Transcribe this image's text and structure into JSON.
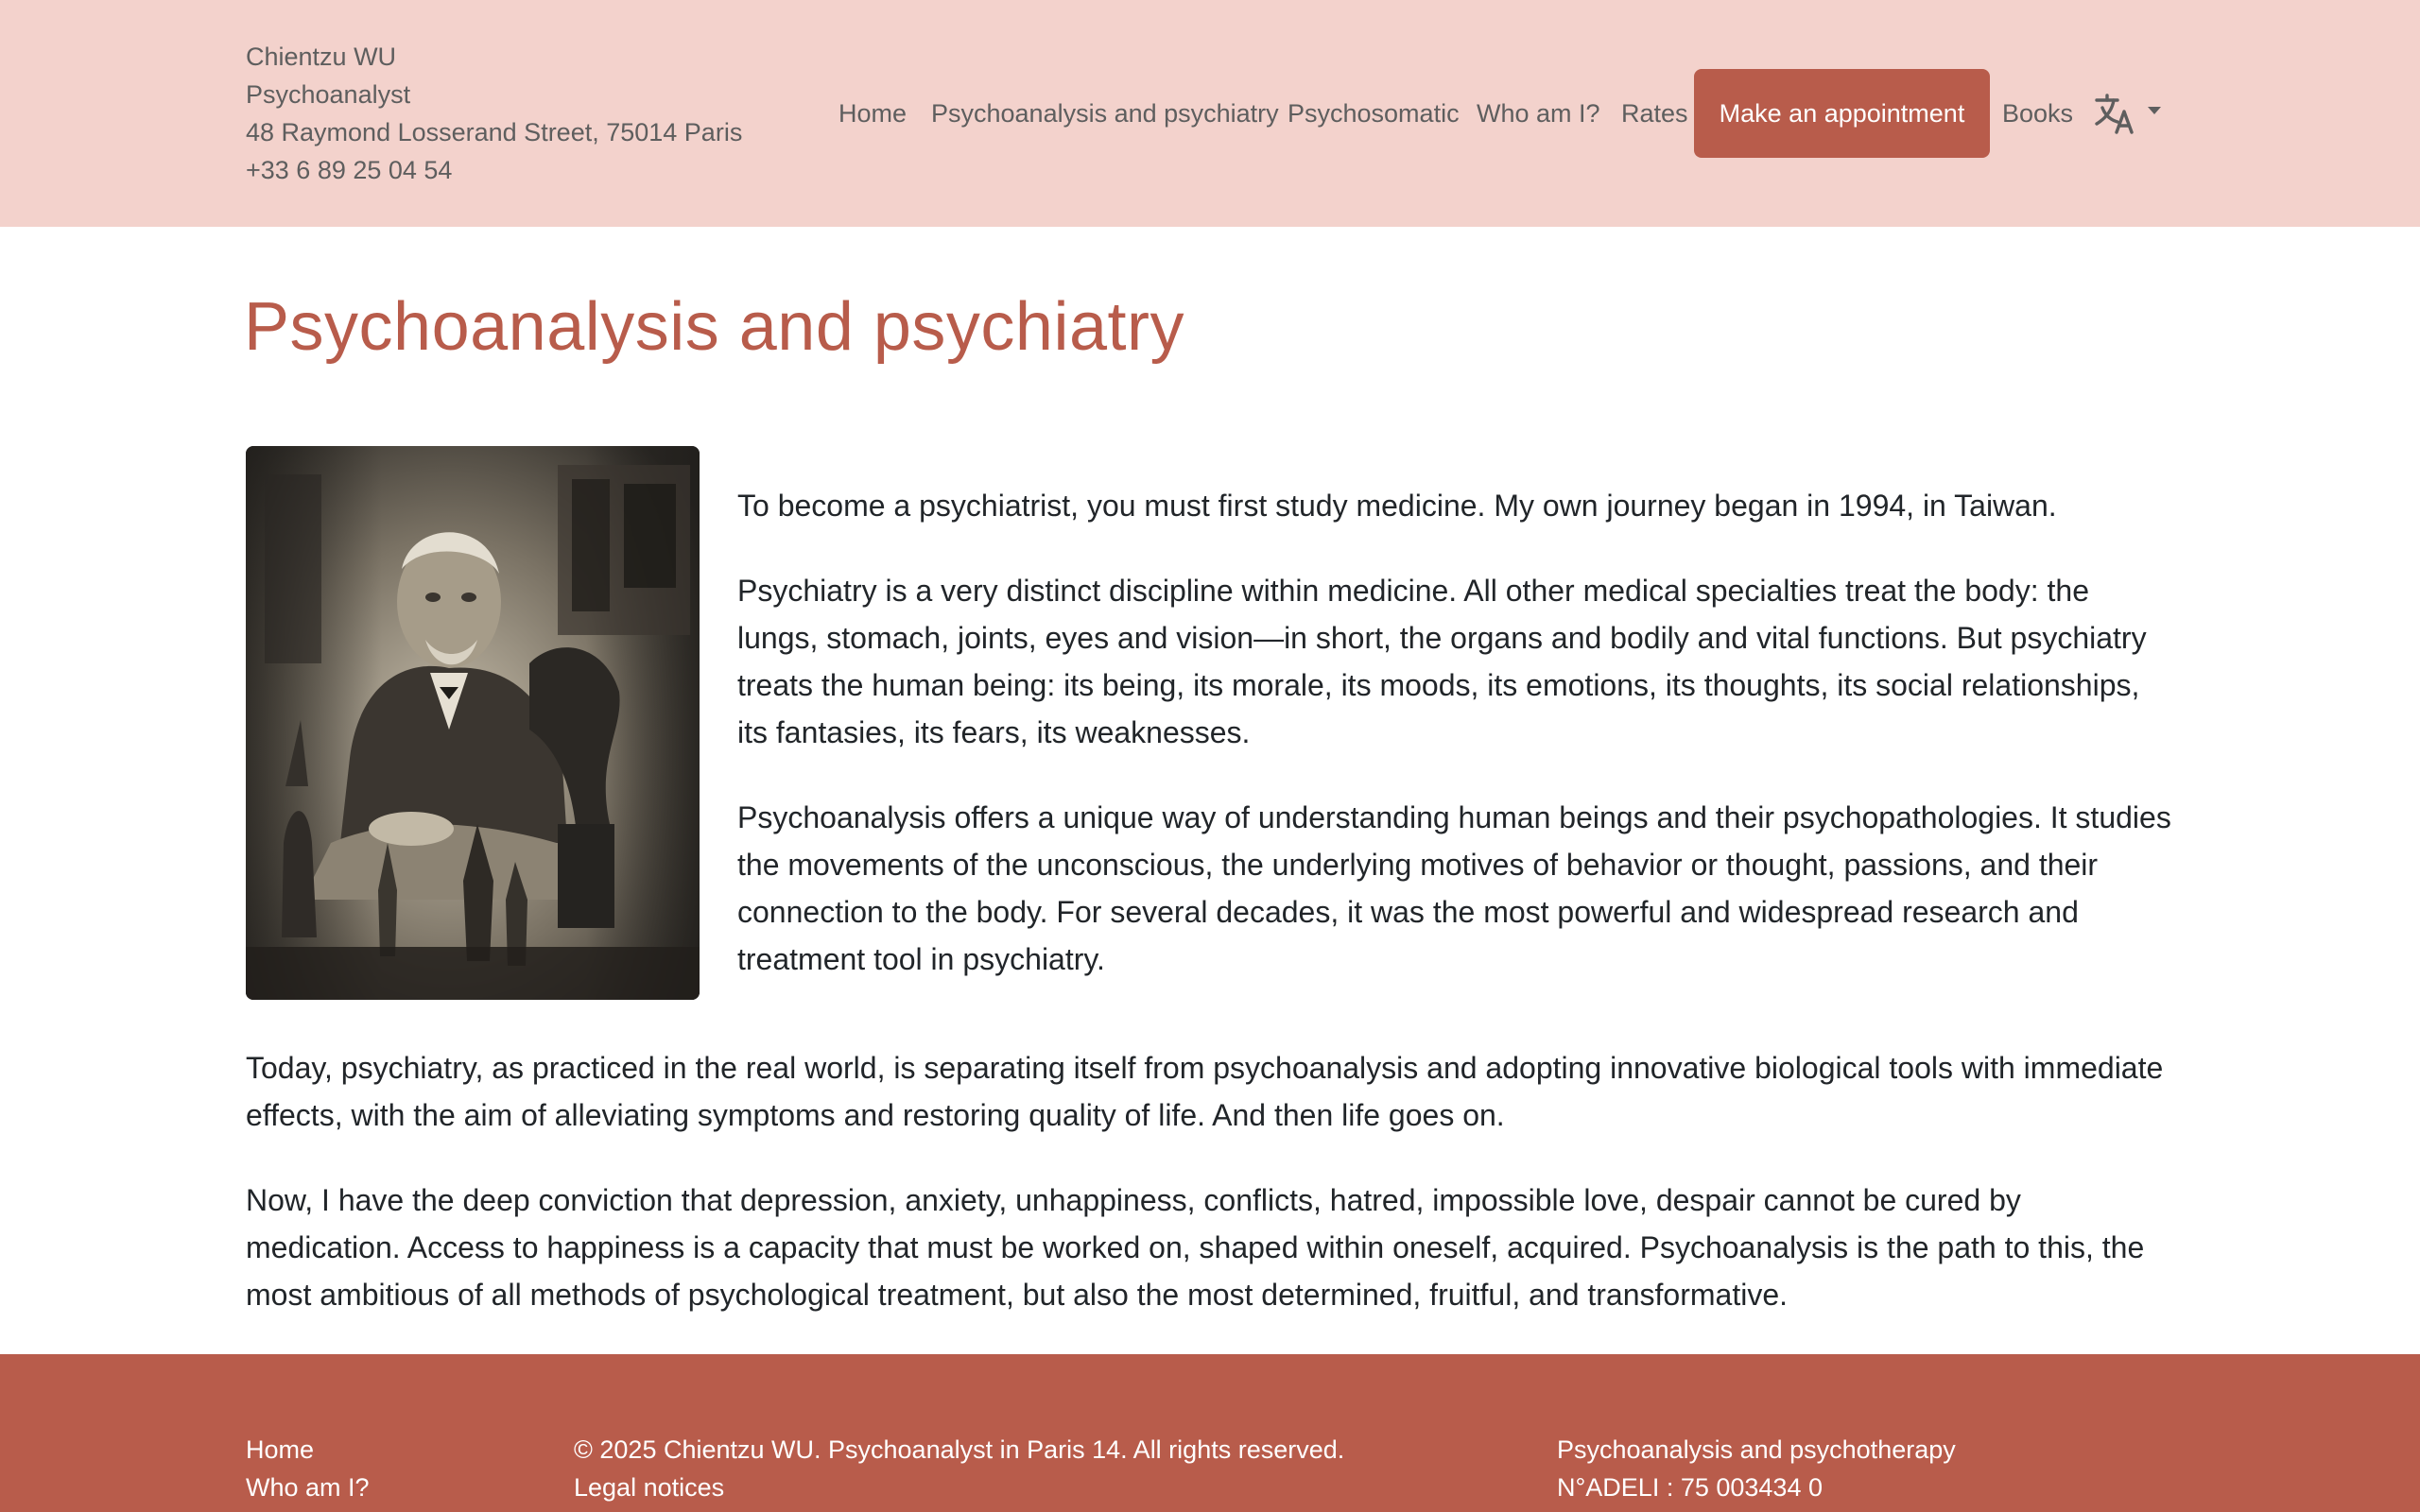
{
  "header": {
    "name": "Chientzu WU",
    "profession": "Psychoanalyst",
    "address": "48 Raymond Losserand Street, 75014 Paris",
    "phone": "+33 6 89 25 04 54"
  },
  "nav": {
    "items": [
      {
        "label": "Home"
      },
      {
        "label": "Psychoanalysis and psychiatry"
      },
      {
        "label": "Psychosomatic"
      },
      {
        "label": "Who am I?"
      },
      {
        "label": "Rates"
      }
    ],
    "cta_label": "Make an appointment",
    "books_label": "Books",
    "language_icon": "translate-icon"
  },
  "main": {
    "title": "Psychoanalysis and psychiatry",
    "paragraphs": [
      "To become a psychiatrist, you must first study medicine. My own journey began in 1994, in Taiwan.",
      "Psychiatry is a very distinct discipline within medicine. All other medical specialties treat the body: the lungs, stomach, joints, eyes and vision—in short, the organs and bodily and vital functions. But psychiatry treats the human being: its being, its morale, its moods, its emotions, its thoughts, its social relationships, its fantasies, its fears, its weaknesses.",
      "Psychoanalysis offers a unique way of understanding human beings and their psychopathologies. It studies the movements of the unconscious, the underlying motives of behavior or thought, passions, and their connection to the body. For several decades, it was the most powerful and widespread research and treatment tool in psychiatry.",
      "Today, psychiatry, as practiced in the real world, is separating itself from psychoanalysis and adopting innovative biological tools with immediate effects, with the aim of alleviating symptoms and restoring quality of life. And then life goes on.",
      "Now, I have the deep conviction that depression, anxiety, unhappiness, conflicts, hatred, impossible love, despair cannot be cured by medication. Access to happiness is a capacity that must be worked on, shaped within oneself, acquired. Psychoanalysis is the path to this, the most ambitious of all methods of psychological treatment, but also the most determined, fruitful, and transformative."
    ]
  },
  "footer": {
    "links": [
      "Home",
      "Who am I?"
    ],
    "copyright": "© 2025 Chientzu WU. Psychoanalyst in Paris 14. All rights reserved.",
    "legal": "Legal notices",
    "tagline": "Psychoanalysis and psychotherapy",
    "adeli": "N°ADELI : 75 003434 0"
  },
  "colors": {
    "header_bg": "#f3d2cc",
    "accent": "#b85c4b",
    "text": "#212529",
    "muted": "#5e5e5e"
  }
}
